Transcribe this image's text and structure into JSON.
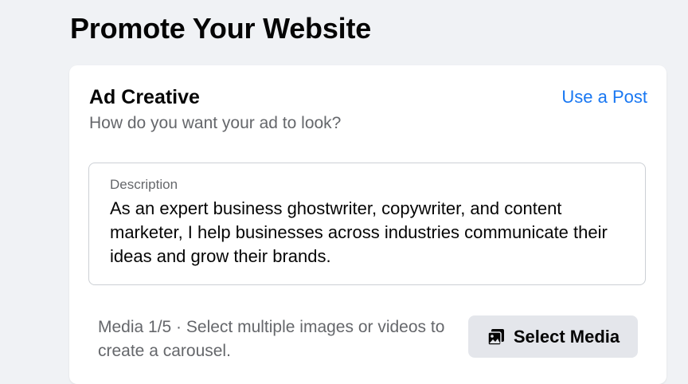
{
  "page": {
    "title": "Promote Your Website"
  },
  "ad_creative": {
    "title": "Ad Creative",
    "subtitle": "How do you want your ad to look?",
    "use_post_link": "Use a Post",
    "description": {
      "label": "Description",
      "value": "As an expert business ghostwriter, copywriter, and content marketer, I help businesses across industries communicate their ideas and grow their brands."
    },
    "media": {
      "hint": "Media 1/5 · Select multiple images or videos to create a carousel.",
      "button_label": "Select Media",
      "button_icon": "photos-icon"
    }
  },
  "colors": {
    "background": "#f0f2f5",
    "card": "#ffffff",
    "link": "#1877f2",
    "secondary_text": "#65676b",
    "button_bg": "#e4e6eb"
  }
}
